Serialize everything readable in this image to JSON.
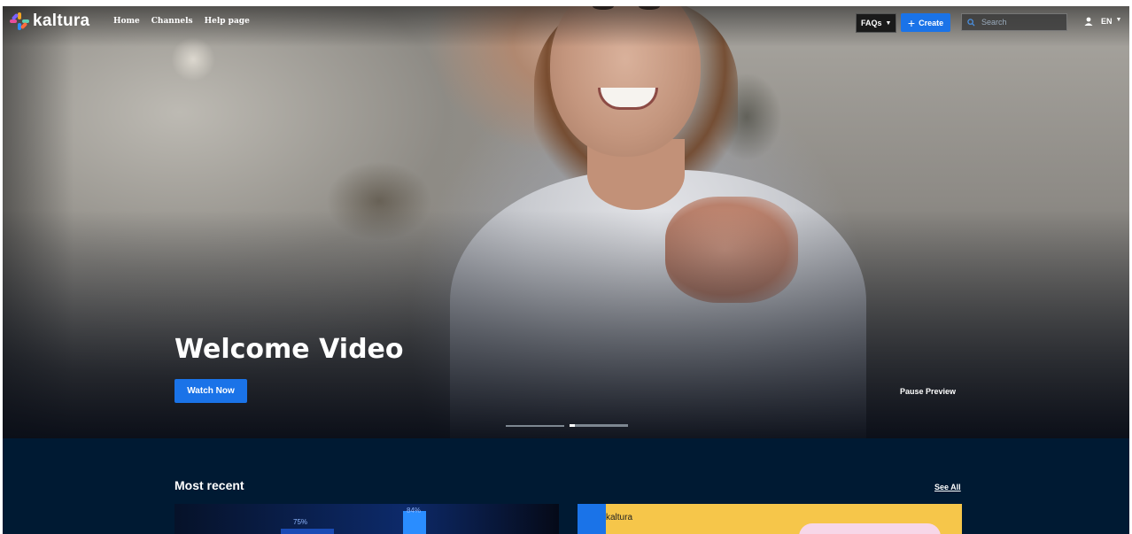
{
  "brand": {
    "name": "kaltura"
  },
  "nav": {
    "links": [
      "Home",
      "Channels",
      "Help page"
    ],
    "faqs_label": "FAQs",
    "create_label": "Create",
    "search_placeholder": "Search",
    "language": "EN"
  },
  "hero": {
    "title": "Welcome Video",
    "cta_label": "Watch Now",
    "pause_label": "Pause Preview",
    "slides": 2,
    "active_slide": 2
  },
  "recent": {
    "title": "Most recent",
    "see_all_label": "See All",
    "cards": [
      {
        "labels": [
          "75%",
          "84%"
        ]
      },
      {
        "brand": "kaltura"
      }
    ]
  },
  "colors": {
    "accent": "#1a73e8",
    "page_bg": "#001a33"
  },
  "icons": [
    "kaltura-logo-icon",
    "chevron-down-icon",
    "plus-icon",
    "search-icon",
    "user-icon"
  ]
}
